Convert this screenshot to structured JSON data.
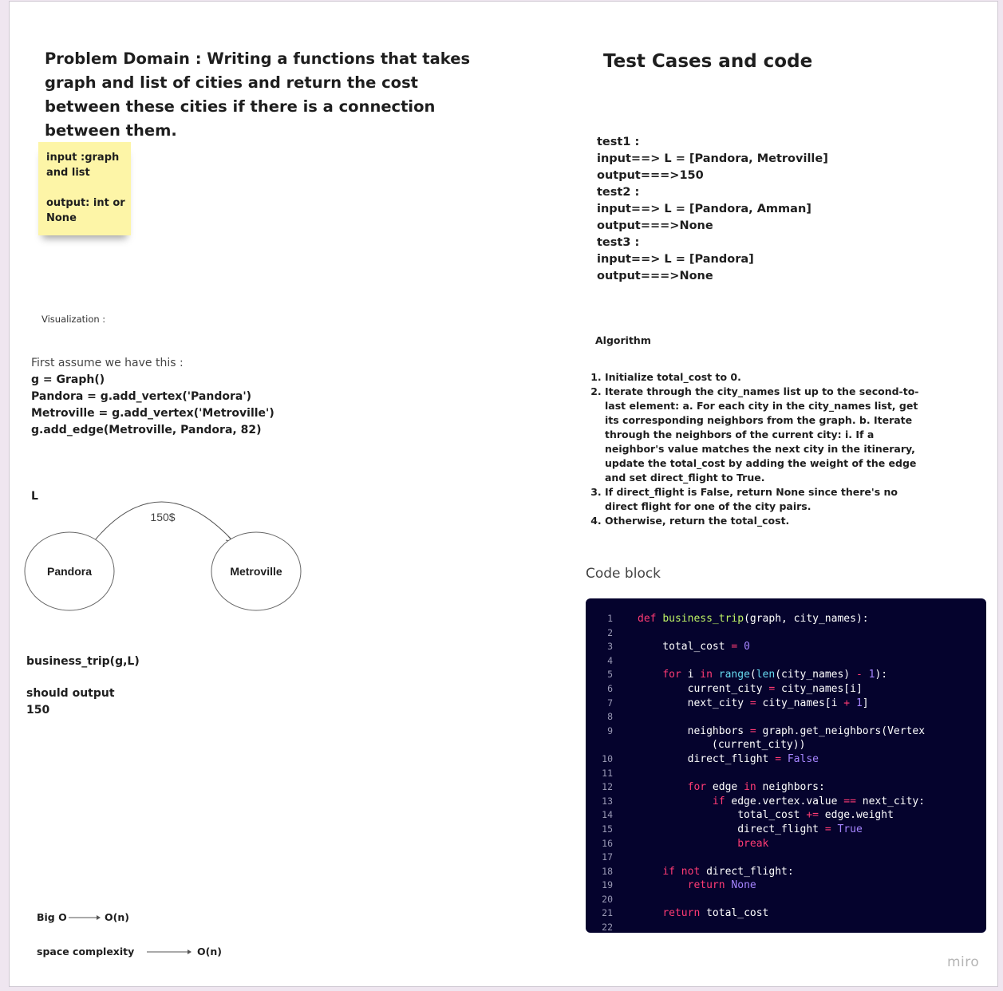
{
  "problem": {
    "title": "Problem Domain : Writing a functions that takes graph and list of cities and return the cost between these cities if there is a connection between them."
  },
  "sticky_note": {
    "line1": "input :graph",
    "line2": "and list",
    "line3": "output: int or",
    "line4": "None"
  },
  "visualization": {
    "label": "Visualization :",
    "assume": "First assume we have this :",
    "code_lines": [
      "g = Graph()",
      "Pandora = g.add_vertex('Pandora')",
      "Metroville = g.add_vertex('Metroville')",
      "g.add_edge(Metroville, Pandora, 82)"
    ],
    "list_label": "L",
    "graph": {
      "node_a": "Pandora",
      "node_b": "Metroville",
      "edge_label": "150$"
    },
    "call": "business_trip(g,L)",
    "should_output": "should output",
    "output_value": "150"
  },
  "complexity": {
    "big_o_label": "Big O",
    "big_o_value": "O(n)",
    "space_label": "space complexity",
    "space_value": "O(n)"
  },
  "tests": {
    "title": "Test Cases and code",
    "lines": [
      "test1 :",
      "input==> L = [Pandora, Metroville]",
      "output===>150",
      "test2 :",
      "input==> L = [Pandora, Amman]",
      "output===>None",
      "test3 :",
      "input==> L = [Pandora]",
      "output===>None"
    ]
  },
  "algorithm": {
    "label": "Algorithm",
    "steps": [
      "Initialize total_cost to 0.",
      "Iterate through the city_names list up to the second-to-last element: a. For each city in the city_names list, get its corresponding neighbors from the graph. b. Iterate through the neighbors of the current city: i. If a neighbor's value matches the next city in the itinerary, update the total_cost by adding the weight of the edge and set direct_flight to True.",
      "If direct_flight is False, return None since there's no direct flight for one of the city pairs.",
      "Otherwise, return the total_cost."
    ]
  },
  "code_block": {
    "label": "Code block",
    "lines": [
      "def business_trip(graph, city_names):",
      "",
      "    total_cost = 0",
      "",
      "    for i in range(len(city_names) - 1):",
      "        current_city = city_names[i]",
      "        next_city = city_names[i + 1]",
      "",
      "        neighbors = graph.get_neighbors(Vertex",
      "(current_city))",
      "        direct_flight = False",
      "",
      "        for edge in neighbors:",
      "            if edge.vertex.value == next_city:",
      "                total_cost += edge.weight",
      "                direct_flight = True",
      "                break",
      "",
      "    if not direct_flight:",
      "        return None",
      "",
      "    return total_cost",
      ""
    ],
    "line_numbers": [
      "1",
      "2",
      "3",
      "4",
      "5",
      "6",
      "7",
      "8",
      "9",
      "",
      "10",
      "11",
      "12",
      "13",
      "14",
      "15",
      "16",
      "17",
      "18",
      "19",
      "20",
      "21",
      "22"
    ]
  },
  "brand": {
    "logo_text": "miro"
  },
  "colors": {
    "sticky": "#fdf5a7",
    "code_bg": "#05032d",
    "keyword": "#ff3b74",
    "function": "#bef264",
    "builtin": "#66d9ef",
    "number": "#a685ff"
  }
}
